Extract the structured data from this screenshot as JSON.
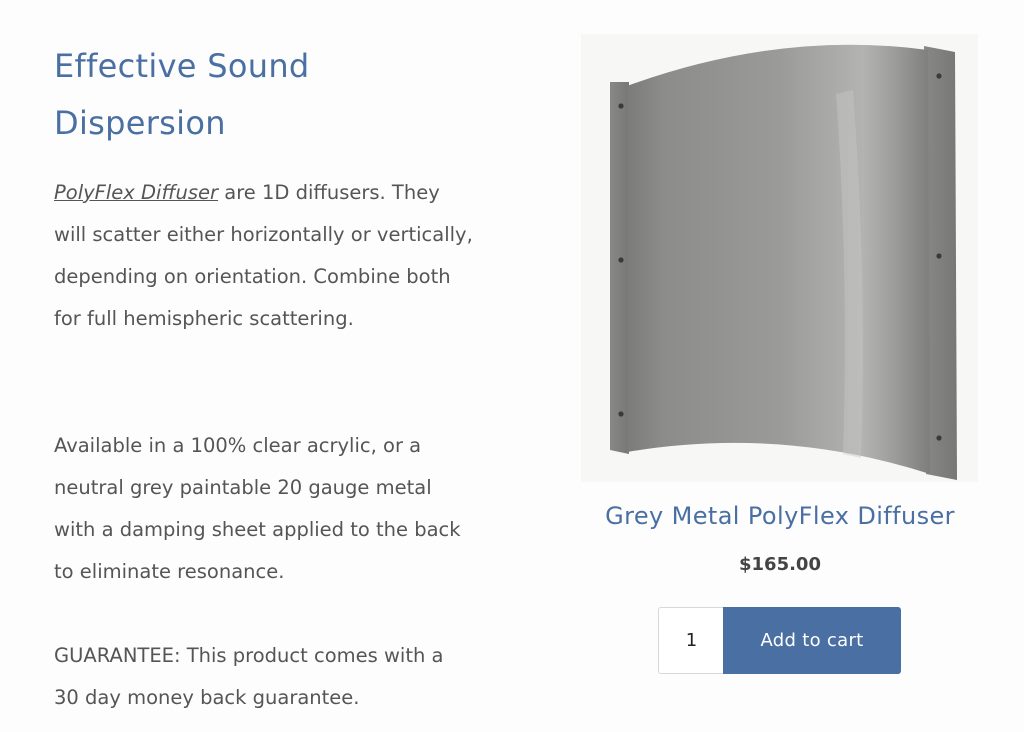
{
  "section": {
    "heading": "Effective Sound Dispersion",
    "paragraph1": {
      "link_text": "PolyFlex Diffuser",
      "rest": " are 1D diffusers. They will scatter either horizontally or vertically, depending on orientation. Combine both for full hemispheric scattering."
    },
    "paragraph2": "Available in a 100% clear acrylic, or a neutral grey paintable 20 gauge metal with a damping sheet applied to the back to eliminate resonance.",
    "paragraph3": "GUARANTEE: This product comes with a 30 day money back guarantee."
  },
  "product": {
    "image_icon": "metal-diffuser-panel-photo",
    "title": "Grey Metal PolyFlex Diffuser",
    "price": "$165.00",
    "quantity": "1",
    "add_to_cart_label": "Add to cart"
  },
  "colors": {
    "accent": "#4a6fa3",
    "body_text": "#555555",
    "price_text": "#444444",
    "panel_grey": "#8a8a88"
  }
}
